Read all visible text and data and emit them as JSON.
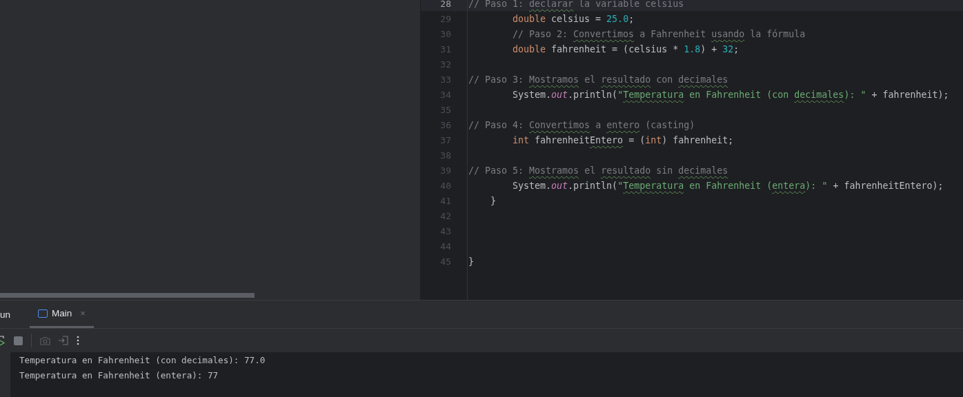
{
  "editor": {
    "lines": [
      {
        "number": "28",
        "current": true,
        "kind": "top",
        "tokens": [
          {
            "kind": "comment",
            "text": "// Paso 1: "
          },
          {
            "kind": "comment_typo",
            "text": "declarar"
          },
          {
            "kind": "comment",
            "text": " la variable celsius"
          }
        ]
      },
      {
        "number": "29",
        "current": false,
        "kind": "body",
        "tokens": [
          {
            "kind": "keyword",
            "text": "double"
          },
          {
            "kind": "plain",
            "text": " celsius = "
          },
          {
            "kind": "number",
            "text": "25.0"
          },
          {
            "kind": "plain",
            "text": ";"
          }
        ]
      },
      {
        "number": "30",
        "current": false,
        "kind": "body",
        "tokens": [
          {
            "kind": "comment",
            "text": "// Paso 2: "
          },
          {
            "kind": "comment_typo",
            "text": "Convertimos"
          },
          {
            "kind": "comment",
            "text": " a Fahrenheit "
          },
          {
            "kind": "comment_typo",
            "text": "usando"
          },
          {
            "kind": "comment",
            "text": " la fórmula"
          }
        ]
      },
      {
        "number": "31",
        "current": false,
        "kind": "body",
        "tokens": [
          {
            "kind": "keyword",
            "text": "double"
          },
          {
            "kind": "plain",
            "text": " fahrenheit = (celsius * "
          },
          {
            "kind": "number",
            "text": "1.8"
          },
          {
            "kind": "plain",
            "text": ") + "
          },
          {
            "kind": "number",
            "text": "32"
          },
          {
            "kind": "plain",
            "text": ";"
          }
        ]
      },
      {
        "number": "32",
        "current": false
      },
      {
        "number": "33",
        "current": false,
        "kind": "top",
        "tokens": [
          {
            "kind": "comment",
            "text": "// Paso 3: "
          },
          {
            "kind": "comment_typo",
            "text": "Mostramos"
          },
          {
            "kind": "comment",
            "text": " el "
          },
          {
            "kind": "comment_typo",
            "text": "resultado"
          },
          {
            "kind": "comment",
            "text": " con "
          },
          {
            "kind": "comment_typo",
            "text": "decimales"
          }
        ]
      },
      {
        "number": "34",
        "current": false,
        "kind": "body",
        "tokens": [
          {
            "kind": "plain",
            "text": "System."
          },
          {
            "kind": "field",
            "text": "out"
          },
          {
            "kind": "plain",
            "text": ".println("
          },
          {
            "kind": "string",
            "text": "\""
          },
          {
            "kind": "string_typo",
            "text": "Temperatura"
          },
          {
            "kind": "string",
            "text": " en Fahrenheit (con "
          },
          {
            "kind": "string_typo",
            "text": "decimales"
          },
          {
            "kind": "string",
            "text": "): \""
          },
          {
            "kind": "plain",
            "text": " + fahrenheit);"
          }
        ]
      },
      {
        "number": "35",
        "current": false
      },
      {
        "number": "36",
        "current": false,
        "kind": "top",
        "tokens": [
          {
            "kind": "comment",
            "text": "// Paso 4: "
          },
          {
            "kind": "comment_typo",
            "text": "Convertimos"
          },
          {
            "kind": "comment",
            "text": " a "
          },
          {
            "kind": "comment_typo",
            "text": "entero"
          },
          {
            "kind": "comment",
            "text": " (casting)"
          }
        ]
      },
      {
        "number": "37",
        "current": false,
        "kind": "body",
        "tokens": [
          {
            "kind": "keyword",
            "text": "int"
          },
          {
            "kind": "plain",
            "text": " fahrenheit"
          },
          {
            "kind": "plain_typo",
            "text": "Entero"
          },
          {
            "kind": "plain",
            "text": " = ("
          },
          {
            "kind": "keyword",
            "text": "int"
          },
          {
            "kind": "plain",
            "text": ") fahrenheit;"
          }
        ]
      },
      {
        "number": "38",
        "current": false
      },
      {
        "number": "39",
        "current": false,
        "kind": "top",
        "tokens": [
          {
            "kind": "comment",
            "text": "// Paso 5: "
          },
          {
            "kind": "comment_typo",
            "text": "Mostramos"
          },
          {
            "kind": "comment",
            "text": " el "
          },
          {
            "kind": "comment_typo",
            "text": "resultado"
          },
          {
            "kind": "comment",
            "text": " sin "
          },
          {
            "kind": "comment_typo",
            "text": "decimales"
          }
        ]
      },
      {
        "number": "40",
        "current": false,
        "kind": "body",
        "tokens": [
          {
            "kind": "plain",
            "text": "System."
          },
          {
            "kind": "field",
            "text": "out"
          },
          {
            "kind": "plain",
            "text": ".println("
          },
          {
            "kind": "string",
            "text": "\""
          },
          {
            "kind": "string_typo",
            "text": "Temperatura"
          },
          {
            "kind": "string",
            "text": " en Fahrenheit ("
          },
          {
            "kind": "string_typo",
            "text": "entera"
          },
          {
            "kind": "string",
            "text": "): \""
          },
          {
            "kind": "plain",
            "text": " + fahrenheitEntero);"
          }
        ]
      },
      {
        "number": "41",
        "current": false,
        "kind": "inner",
        "tokens": [
          {
            "kind": "plain",
            "text": "}"
          }
        ]
      },
      {
        "number": "42",
        "current": false
      },
      {
        "number": "43",
        "current": false
      },
      {
        "number": "44",
        "current": false
      },
      {
        "number": "45",
        "current": false,
        "kind": "top",
        "tokens": [
          {
            "kind": "plain",
            "text": "}"
          }
        ]
      }
    ]
  },
  "run_panel": {
    "title": "un",
    "tabs": [
      {
        "label": "Main",
        "selected": true,
        "close": "×"
      }
    ],
    "console": [
      "Temperatura en Fahrenheit (con decimales): 77.0",
      "Temperatura en Fahrenheit (entera): 77"
    ]
  }
}
